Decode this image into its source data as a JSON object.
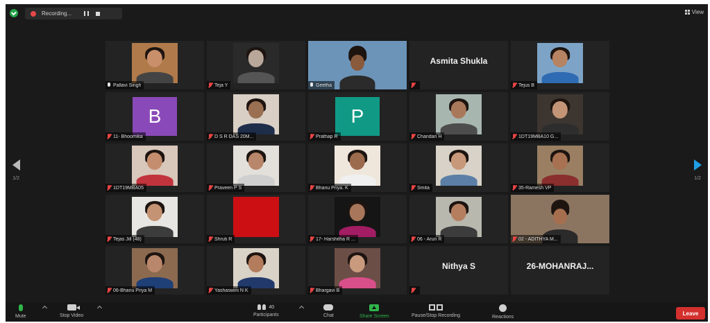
{
  "topbar": {
    "recording_label": "Recording...",
    "view_label": "View"
  },
  "nav": {
    "page_left": "1/2",
    "page_right": "1/2"
  },
  "participants": [
    {
      "name": "Pallavi Singh",
      "muted": false,
      "kind": "video",
      "bg": "#b07a4a",
      "skin": "#c98f6b",
      "shirt": "#444444",
      "active": false
    },
    {
      "name": "Teja Y",
      "muted": true,
      "kind": "video",
      "bg": "#2a2a2a",
      "skin": "#b9a79a",
      "shirt": "#555555",
      "active": false
    },
    {
      "name": "Geetha",
      "muted": false,
      "kind": "scene",
      "bg": "#6c94b8",
      "skin": "#8a5a3c",
      "shirt": "#2b2b2b",
      "active": true
    },
    {
      "name": "Asmita Shukla",
      "muted": true,
      "kind": "name"
    },
    {
      "name": "Tejus B",
      "muted": true,
      "kind": "video",
      "bg": "#7da4c6",
      "skin": "#b68363",
      "shirt": "#2f6bb3",
      "active": false
    },
    {
      "name": "11- Bhoomika",
      "muted": true,
      "kind": "avatar",
      "letter": "B",
      "avatar_color": "#8a49b8"
    },
    {
      "name": "D S R DAS 20M...",
      "muted": true,
      "kind": "video",
      "bg": "#d9cfc4",
      "skin": "#9b6f52",
      "shirt": "#1e2d4a",
      "active": false
    },
    {
      "name": "Prathap R",
      "muted": true,
      "kind": "avatar",
      "letter": "P",
      "avatar_color": "#109a86"
    },
    {
      "name": "Chandan H",
      "muted": true,
      "kind": "video",
      "bg": "#a8b6b0",
      "skin": "#a9785a",
      "shirt": "#4d4d4d",
      "active": false
    },
    {
      "name": "1DT19MBA10 G...",
      "muted": true,
      "kind": "video",
      "bg": "#3d3530",
      "skin": "#c49476",
      "shirt": "#2d2d2d",
      "active": false
    },
    {
      "name": "1DT19MBA05",
      "muted": true,
      "kind": "video",
      "bg": "#d8c7bb",
      "skin": "#c48e6e",
      "shirt": "#c2343d",
      "active": false
    },
    {
      "name": "Praveen P S",
      "muted": true,
      "kind": "video",
      "bg": "#e3dfda",
      "skin": "#b8866a",
      "shirt": "#cfcfcf",
      "active": false
    },
    {
      "name": "Bhanu Priya. K",
      "muted": true,
      "kind": "video",
      "bg": "#efe7dc",
      "skin": "#9c6b4d",
      "shirt": "#f0f0f0",
      "active": false
    },
    {
      "name": "Smita",
      "muted": true,
      "kind": "video",
      "bg": "#d8d2c8",
      "skin": "#c79879",
      "shirt": "#5b7fa6",
      "active": false
    },
    {
      "name": "35-Ramesh VP",
      "muted": true,
      "kind": "video",
      "bg": "#9a7f63",
      "skin": "#a87151",
      "shirt": "#8a2e2e",
      "active": false
    },
    {
      "name": "Tejas Jill (48)",
      "muted": true,
      "kind": "video",
      "bg": "#e8e6e2",
      "skin": "#c49373",
      "shirt": "#3c3c3c",
      "active": false
    },
    {
      "name": "Shruti R",
      "muted": true,
      "kind": "solid",
      "bg": "#cc0f13"
    },
    {
      "name": "17- Harshitha R ...",
      "muted": true,
      "kind": "video",
      "bg": "#151515",
      "skin": "#a8765a",
      "shirt": "#a21d63",
      "active": false
    },
    {
      "name": "06 - Arun R",
      "muted": true,
      "kind": "video",
      "bg": "#b8b8ae",
      "skin": "#b57f5f",
      "shirt": "#3c3c3c",
      "active": false
    },
    {
      "name": "02 - ADITHYA M...",
      "muted": true,
      "kind": "scene",
      "bg": "#8c7560",
      "skin": "#a56f4f",
      "shirt": "#2a2a2a",
      "active": false
    },
    {
      "name": "06-Bhanu Priya M",
      "muted": true,
      "kind": "video",
      "bg": "#8c6a50",
      "skin": "#b9876b",
      "shirt": "#1f3f77",
      "active": false
    },
    {
      "name": "Yashaswini N K",
      "muted": true,
      "kind": "video",
      "bg": "#d9d2c7",
      "skin": "#b27c5d",
      "shirt": "#213a6b",
      "active": false
    },
    {
      "name": "Bhargavi B",
      "muted": true,
      "kind": "video",
      "bg": "#6b4e46",
      "skin": "#c99a7e",
      "shirt": "#d94f8a",
      "active": false
    },
    {
      "name": "Nithya S",
      "muted": true,
      "kind": "name"
    },
    {
      "name": "26-MOHANRAJ...",
      "muted": false,
      "kind": "name_nolabel"
    }
  ],
  "toolbar": {
    "mute": "Mute",
    "stop_video": "Stop Video",
    "participants": "Participants",
    "participants_count": "40",
    "chat": "Chat",
    "share_screen": "Share Screen",
    "recording": "Pause/Stop Recording",
    "reactions": "Reactions",
    "leave": "Leave"
  }
}
